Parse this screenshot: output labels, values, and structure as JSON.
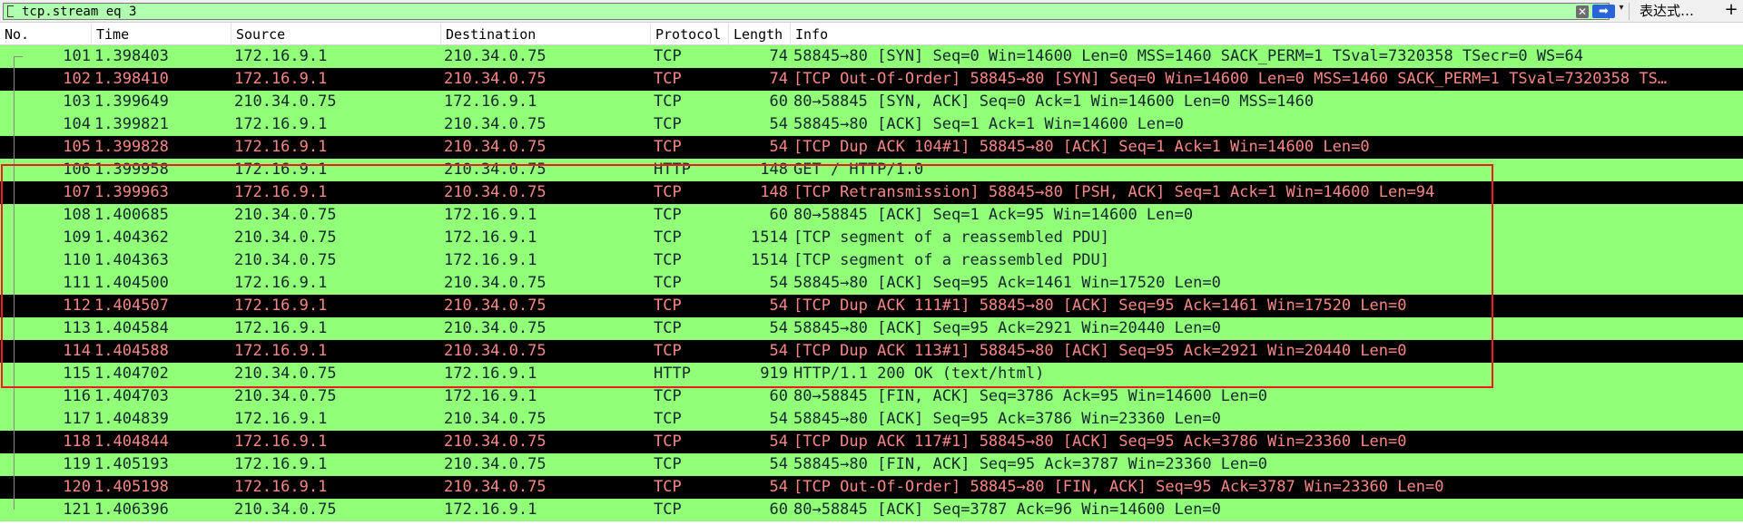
{
  "filter": {
    "value": "tcp.stream eq 3",
    "clear_icon": "✕",
    "apply_icon": "➡",
    "dropdown_icon": "▾",
    "expression_label": "表达式…",
    "add_icon": "+"
  },
  "columns": {
    "no": "No.",
    "time": "Time",
    "source": "Source",
    "destination": "Destination",
    "protocol": "Protocol",
    "length": "Length",
    "info": "Info"
  },
  "colors": {
    "row_green": "#92ff79",
    "row_black": "#000000",
    "text_dark": "#12272e",
    "text_red": "#f78787",
    "highlight": "#ee1c1c"
  },
  "packets": [
    {
      "no": "101",
      "time": "1.398403",
      "src": "172.16.9.1",
      "dst": "210.34.0.75",
      "proto": "TCP",
      "len": "74",
      "info": "58845→80 [SYN] Seq=0 Win=14600 Len=0 MSS=1460 SACK_PERM=1 TSval=7320358 TSecr=0 WS=64",
      "style": "green"
    },
    {
      "no": "102",
      "time": "1.398410",
      "src": "172.16.9.1",
      "dst": "210.34.0.75",
      "proto": "TCP",
      "len": "74",
      "info": "[TCP Out-Of-Order] 58845→80 [SYN] Seq=0 Win=14600 Len=0 MSS=1460 SACK_PERM=1 TSval=7320358 TS…",
      "style": "black"
    },
    {
      "no": "103",
      "time": "1.399649",
      "src": "210.34.0.75",
      "dst": "172.16.9.1",
      "proto": "TCP",
      "len": "60",
      "info": "80→58845 [SYN, ACK] Seq=0 Ack=1 Win=14600 Len=0 MSS=1460",
      "style": "green"
    },
    {
      "no": "104",
      "time": "1.399821",
      "src": "172.16.9.1",
      "dst": "210.34.0.75",
      "proto": "TCP",
      "len": "54",
      "info": "58845→80 [ACK] Seq=1 Ack=1 Win=14600 Len=0",
      "style": "green"
    },
    {
      "no": "105",
      "time": "1.399828",
      "src": "172.16.9.1",
      "dst": "210.34.0.75",
      "proto": "TCP",
      "len": "54",
      "info": "[TCP Dup ACK 104#1] 58845→80 [ACK] Seq=1 Ack=1 Win=14600 Len=0",
      "style": "black"
    },
    {
      "no": "106",
      "time": "1.399958",
      "src": "172.16.9.1",
      "dst": "210.34.0.75",
      "proto": "HTTP",
      "len": "148",
      "info": "GET / HTTP/1.0",
      "style": "green"
    },
    {
      "no": "107",
      "time": "1.399963",
      "src": "172.16.9.1",
      "dst": "210.34.0.75",
      "proto": "TCP",
      "len": "148",
      "info": "[TCP Retransmission] 58845→80 [PSH, ACK] Seq=1 Ack=1 Win=14600 Len=94",
      "style": "black"
    },
    {
      "no": "108",
      "time": "1.400685",
      "src": "210.34.0.75",
      "dst": "172.16.9.1",
      "proto": "TCP",
      "len": "60",
      "info": "80→58845 [ACK] Seq=1 Ack=95 Win=14600 Len=0",
      "style": "green"
    },
    {
      "no": "109",
      "time": "1.404362",
      "src": "210.34.0.75",
      "dst": "172.16.9.1",
      "proto": "TCP",
      "len": "1514",
      "info": "[TCP segment of a reassembled PDU]",
      "style": "green"
    },
    {
      "no": "110",
      "time": "1.404363",
      "src": "210.34.0.75",
      "dst": "172.16.9.1",
      "proto": "TCP",
      "len": "1514",
      "info": "[TCP segment of a reassembled PDU]",
      "style": "green"
    },
    {
      "no": "111",
      "time": "1.404500",
      "src": "172.16.9.1",
      "dst": "210.34.0.75",
      "proto": "TCP",
      "len": "54",
      "info": "58845→80 [ACK] Seq=95 Ack=1461 Win=17520 Len=0",
      "style": "green"
    },
    {
      "no": "112",
      "time": "1.404507",
      "src": "172.16.9.1",
      "dst": "210.34.0.75",
      "proto": "TCP",
      "len": "54",
      "info": "[TCP Dup ACK 111#1] 58845→80 [ACK] Seq=95 Ack=1461 Win=17520 Len=0",
      "style": "black"
    },
    {
      "no": "113",
      "time": "1.404584",
      "src": "172.16.9.1",
      "dst": "210.34.0.75",
      "proto": "TCP",
      "len": "54",
      "info": "58845→80 [ACK] Seq=95 Ack=2921 Win=20440 Len=0",
      "style": "green"
    },
    {
      "no": "114",
      "time": "1.404588",
      "src": "172.16.9.1",
      "dst": "210.34.0.75",
      "proto": "TCP",
      "len": "54",
      "info": "[TCP Dup ACK 113#1] 58845→80 [ACK] Seq=95 Ack=2921 Win=20440 Len=0",
      "style": "black"
    },
    {
      "no": "115",
      "time": "1.404702",
      "src": "210.34.0.75",
      "dst": "172.16.9.1",
      "proto": "HTTP",
      "len": "919",
      "info": "HTTP/1.1 200 OK  (text/html)",
      "style": "green"
    },
    {
      "no": "116",
      "time": "1.404703",
      "src": "210.34.0.75",
      "dst": "172.16.9.1",
      "proto": "TCP",
      "len": "60",
      "info": "80→58845 [FIN, ACK] Seq=3786 Ack=95 Win=14600 Len=0",
      "style": "green"
    },
    {
      "no": "117",
      "time": "1.404839",
      "src": "172.16.9.1",
      "dst": "210.34.0.75",
      "proto": "TCP",
      "len": "54",
      "info": "58845→80 [ACK] Seq=95 Ack=3786 Win=23360 Len=0",
      "style": "green"
    },
    {
      "no": "118",
      "time": "1.404844",
      "src": "172.16.9.1",
      "dst": "210.34.0.75",
      "proto": "TCP",
      "len": "54",
      "info": "[TCP Dup ACK 117#1] 58845→80 [ACK] Seq=95 Ack=3786 Win=23360 Len=0",
      "style": "black"
    },
    {
      "no": "119",
      "time": "1.405193",
      "src": "172.16.9.1",
      "dst": "210.34.0.75",
      "proto": "TCP",
      "len": "54",
      "info": "58845→80 [FIN, ACK] Seq=95 Ack=3787 Win=23360 Len=0",
      "style": "green"
    },
    {
      "no": "120",
      "time": "1.405198",
      "src": "172.16.9.1",
      "dst": "210.34.0.75",
      "proto": "TCP",
      "len": "54",
      "info": "[TCP Out-Of-Order] 58845→80 [FIN, ACK] Seq=95 Ack=3787 Win=23360 Len=0",
      "style": "black"
    },
    {
      "no": "121",
      "time": "1.406396",
      "src": "210.34.0.75",
      "dst": "172.16.9.1",
      "proto": "TCP",
      "len": "60",
      "info": "80→58845 [ACK] Seq=3787 Ack=96 Win=14600 Len=0",
      "style": "green"
    }
  ]
}
